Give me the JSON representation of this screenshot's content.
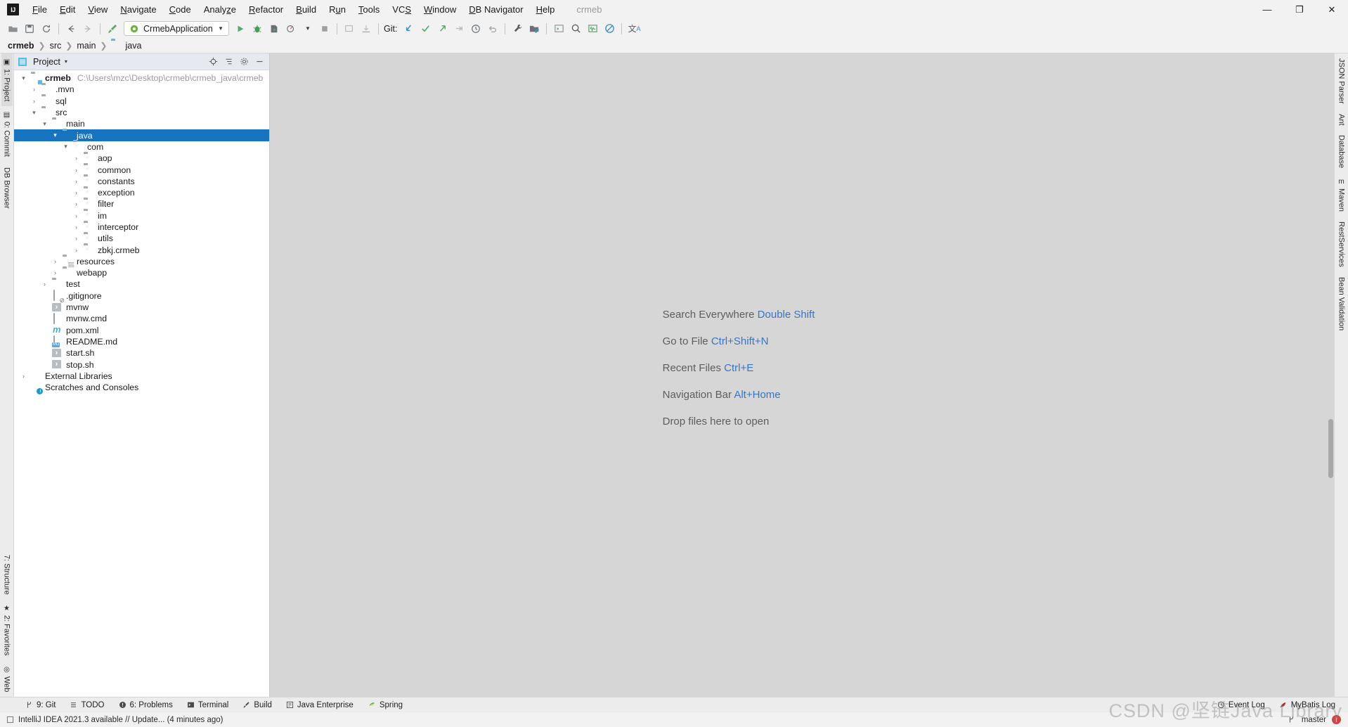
{
  "window": {
    "project_title": "crmeb",
    "controls": {
      "minimize": "—",
      "maximize": "❐",
      "close": "✕"
    }
  },
  "menu": {
    "items": [
      {
        "label": "File"
      },
      {
        "label": "Edit"
      },
      {
        "label": "View"
      },
      {
        "label": "Navigate"
      },
      {
        "label": "Code"
      },
      {
        "label": "Analyze"
      },
      {
        "label": "Refactor"
      },
      {
        "label": "Build"
      },
      {
        "label": "Run"
      },
      {
        "label": "Tools"
      },
      {
        "label": "VCS"
      },
      {
        "label": "Window"
      },
      {
        "label": "DB Navigator"
      },
      {
        "label": "Help"
      }
    ]
  },
  "toolbar": {
    "run_configuration": "CrmebApplication",
    "git_label": "Git:",
    "icons": [
      "open-folder-icon",
      "save-all-icon",
      "sync-icon",
      "back-arrow-icon",
      "forward-arrow-icon",
      "build-hammer-icon",
      "run-icon",
      "debug-icon",
      "run-coverage-icon",
      "profile-icon",
      "stop-icon",
      "deploy-icon",
      "download-icon",
      "update-project-icon",
      "commit-icon",
      "push-icon",
      "revert-icon",
      "history-icon",
      "undo-icon",
      "settings-wrench-icon",
      "project-structure-icon",
      "run-anything-icon",
      "search-icon",
      "monitor-icon",
      "no-access-icon",
      "translate-icon"
    ]
  },
  "breadcrumb": {
    "items": [
      {
        "label": "crmeb",
        "icon": "",
        "bold": true
      },
      {
        "label": "src",
        "icon": "",
        "bold": false
      },
      {
        "label": "main",
        "icon": "",
        "bold": false
      },
      {
        "label": "java",
        "icon": "source-folder-icon",
        "bold": false
      }
    ],
    "separator": "❯"
  },
  "left_stripe": {
    "top": [
      {
        "label": "1: Project",
        "active": true,
        "icon": "project-icon"
      },
      {
        "label": "0: Commit",
        "active": false,
        "icon": "commit-icon"
      },
      {
        "label": "DB Browser",
        "active": false,
        "icon": "db-icon"
      }
    ],
    "bottom": [
      {
        "label": "7: Structure",
        "active": false,
        "icon": "structure-icon"
      },
      {
        "label": "2: Favorites",
        "active": false,
        "icon": "star-icon"
      },
      {
        "label": "Web",
        "active": false,
        "icon": "web-icon"
      }
    ]
  },
  "right_stripe": {
    "items": [
      {
        "label": "JSON Parser"
      },
      {
        "label": "Ant"
      },
      {
        "label": "Database"
      },
      {
        "label": "Maven"
      },
      {
        "label": "RestServices"
      },
      {
        "label": "Bean Validation"
      }
    ]
  },
  "project_panel": {
    "title": "Project",
    "caret": "▾",
    "actions": [
      "locate-target-icon",
      "collapse-all-icon",
      "settings-gear-icon",
      "hide-icon"
    ],
    "tree": [
      {
        "depth": 0,
        "arrow": "▾",
        "icon": "module-icon",
        "label": "crmeb",
        "bold": true,
        "path": "C:\\Users\\mzc\\Desktop\\crmeb\\crmeb_java\\crmeb",
        "selected": false
      },
      {
        "depth": 1,
        "arrow": "›",
        "icon": "folder-icon",
        "label": ".mvn",
        "bold": false,
        "path": "",
        "selected": false
      },
      {
        "depth": 1,
        "arrow": "›",
        "icon": "folder-icon",
        "label": "sql",
        "bold": false,
        "path": "",
        "selected": false
      },
      {
        "depth": 1,
        "arrow": "▾",
        "icon": "folder-icon",
        "label": "src",
        "bold": false,
        "path": "",
        "selected": false
      },
      {
        "depth": 2,
        "arrow": "▾",
        "icon": "folder-icon",
        "label": "main",
        "bold": false,
        "path": "",
        "selected": false
      },
      {
        "depth": 3,
        "arrow": "▾",
        "icon": "source-folder-icon",
        "label": "java",
        "bold": false,
        "path": "",
        "selected": true
      },
      {
        "depth": 4,
        "arrow": "▾",
        "icon": "package-icon",
        "label": "com",
        "bold": false,
        "path": "",
        "selected": false
      },
      {
        "depth": 5,
        "arrow": "›",
        "icon": "package-icon",
        "label": "aop",
        "bold": false,
        "path": "",
        "selected": false
      },
      {
        "depth": 5,
        "arrow": "›",
        "icon": "package-icon",
        "label": "common",
        "bold": false,
        "path": "",
        "selected": false
      },
      {
        "depth": 5,
        "arrow": "›",
        "icon": "package-icon",
        "label": "constants",
        "bold": false,
        "path": "",
        "selected": false
      },
      {
        "depth": 5,
        "arrow": "›",
        "icon": "package-icon",
        "label": "exception",
        "bold": false,
        "path": "",
        "selected": false
      },
      {
        "depth": 5,
        "arrow": "›",
        "icon": "package-icon",
        "label": "filter",
        "bold": false,
        "path": "",
        "selected": false
      },
      {
        "depth": 5,
        "arrow": "›",
        "icon": "package-icon",
        "label": "im",
        "bold": false,
        "path": "",
        "selected": false
      },
      {
        "depth": 5,
        "arrow": "›",
        "icon": "package-icon",
        "label": "interceptor",
        "bold": false,
        "path": "",
        "selected": false
      },
      {
        "depth": 5,
        "arrow": "›",
        "icon": "package-icon",
        "label": "utils",
        "bold": false,
        "path": "",
        "selected": false
      },
      {
        "depth": 5,
        "arrow": "›",
        "icon": "package-icon",
        "label": "zbkj.crmeb",
        "bold": false,
        "path": "",
        "selected": false
      },
      {
        "depth": 3,
        "arrow": "›",
        "icon": "resources-folder-icon",
        "label": "resources",
        "bold": false,
        "path": "",
        "selected": false
      },
      {
        "depth": 3,
        "arrow": "›",
        "icon": "folder-icon",
        "label": "webapp",
        "bold": false,
        "path": "",
        "selected": false
      },
      {
        "depth": 2,
        "arrow": "›",
        "icon": "folder-icon",
        "label": "test",
        "bold": false,
        "path": "",
        "selected": false
      },
      {
        "depth": 2,
        "arrow": "",
        "icon": "gitignore-icon",
        "label": ".gitignore",
        "bold": false,
        "path": "",
        "selected": false
      },
      {
        "depth": 2,
        "arrow": "",
        "icon": "shell-script-icon",
        "label": "mvnw",
        "bold": false,
        "path": "",
        "selected": false
      },
      {
        "depth": 2,
        "arrow": "",
        "icon": "text-file-icon",
        "label": "mvnw.cmd",
        "bold": false,
        "path": "",
        "selected": false
      },
      {
        "depth": 2,
        "arrow": "",
        "icon": "maven-icon",
        "label": "pom.xml",
        "bold": false,
        "path": "",
        "selected": false
      },
      {
        "depth": 2,
        "arrow": "",
        "icon": "markdown-icon",
        "label": "README.md",
        "bold": false,
        "path": "",
        "selected": false
      },
      {
        "depth": 2,
        "arrow": "",
        "icon": "shell-script-icon",
        "label": "start.sh",
        "bold": false,
        "path": "",
        "selected": false
      },
      {
        "depth": 2,
        "arrow": "",
        "icon": "shell-script-icon",
        "label": "stop.sh",
        "bold": false,
        "path": "",
        "selected": false
      },
      {
        "depth": 0,
        "arrow": "›",
        "icon": "library-icon",
        "label": "External Libraries",
        "bold": false,
        "path": "",
        "selected": false
      },
      {
        "depth": 0,
        "arrow": "",
        "icon": "scratches-icon",
        "label": "Scratches and Consoles",
        "bold": false,
        "path": "",
        "selected": false
      }
    ]
  },
  "editor": {
    "hints": [
      {
        "text": "Search Everywhere ",
        "key": "Double Shift"
      },
      {
        "text": "Go to File ",
        "key": "Ctrl+Shift+N"
      },
      {
        "text": "Recent Files ",
        "key": "Ctrl+E"
      },
      {
        "text": "Navigation Bar ",
        "key": "Alt+Home"
      },
      {
        "text": "Drop files here to open",
        "key": ""
      }
    ]
  },
  "tool_window_bar": {
    "items": [
      {
        "label": "9: Git",
        "icon": "git-branch-icon"
      },
      {
        "label": "TODO",
        "icon": "todo-list-icon"
      },
      {
        "label": "6: Problems",
        "icon": "problems-icon"
      },
      {
        "label": "Terminal",
        "icon": "terminal-icon"
      },
      {
        "label": "Build",
        "icon": "build-hammer-icon"
      },
      {
        "label": "Java Enterprise",
        "icon": "java-enterprise-icon"
      },
      {
        "label": "Spring",
        "icon": "spring-leaf-icon"
      }
    ],
    "right_items": [
      {
        "label": "Event Log",
        "icon": "event-log-icon"
      },
      {
        "label": "MyBatis Log",
        "icon": "mybatis-icon"
      }
    ]
  },
  "status_bar": {
    "message": "IntelliJ IDEA 2021.3 available // Update... (4 minutes ago)",
    "branch": "master",
    "branch_icon": "git-branch-icon",
    "warning_badge": "!"
  },
  "watermark": "CSDN @坚链Java Library",
  "colors": {
    "selection_blue": "#1673c0",
    "link_blue": "#3a75c4",
    "editor_bg": "#d6d6d6",
    "panel_bg": "#ffffff",
    "chrome_bg": "#f2f2f2",
    "stripe_bg": "#ececec"
  }
}
